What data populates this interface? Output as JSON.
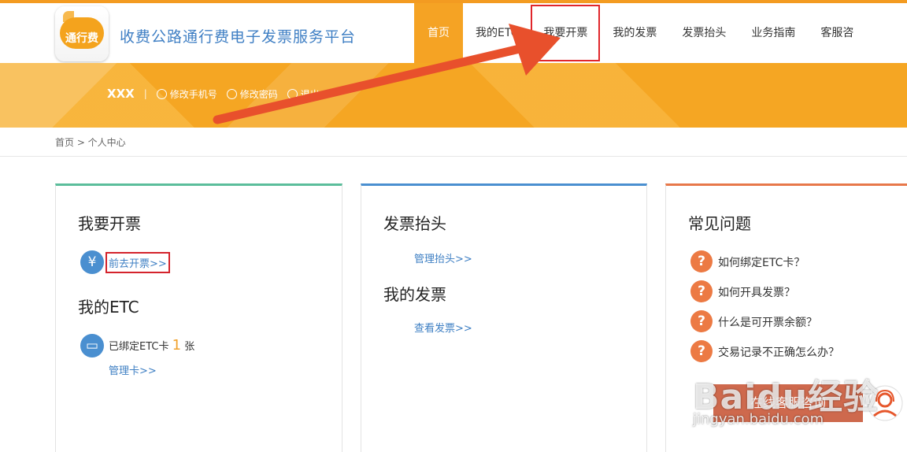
{
  "header": {
    "logo_text": "通行费",
    "site_title": "收费公路通行费电子发票服务平台",
    "nav": [
      {
        "label": "首页"
      },
      {
        "label": "我的ETC"
      },
      {
        "label": "我要开票"
      },
      {
        "label": "我的发票"
      },
      {
        "label": "发票抬头"
      },
      {
        "label": "业务指南"
      },
      {
        "label": "客服咨"
      }
    ]
  },
  "banner": {
    "user_name": "XXX",
    "separator": "|",
    "links": [
      "修改手机号",
      "修改密码",
      "退出"
    ]
  },
  "breadcrumb": "首页 > 个人中心",
  "panel1": {
    "title": "我要开票",
    "invoice_icon": "¥",
    "invoice_link": "前去开票>>",
    "etc_title": "我的ETC",
    "etc_prefix": "已绑定ETC卡",
    "etc_count": "1",
    "etc_unit": "张",
    "manage_card": "管理卡>>"
  },
  "panel2": {
    "title": "发票抬头",
    "manage_title_link": "管理抬头>>",
    "my_invoice_title": "我的发票",
    "view_invoice_link": "查看发票>>"
  },
  "panel3": {
    "title": "常见问题",
    "faqs": [
      "如何绑定ETC卡？",
      "如何开具发票？",
      "什么是可开票余额？",
      "交易记录不正确怎么办？"
    ]
  },
  "chat": {
    "label": "在线客服咨询"
  },
  "watermark": {
    "text": "Baidu经验",
    "sub": "jingyan.baidu.com"
  },
  "colors": {
    "accent": "#f5a324",
    "link": "#3e7fc3",
    "highlight": "#d4232c",
    "arrow": "#e8502c"
  }
}
